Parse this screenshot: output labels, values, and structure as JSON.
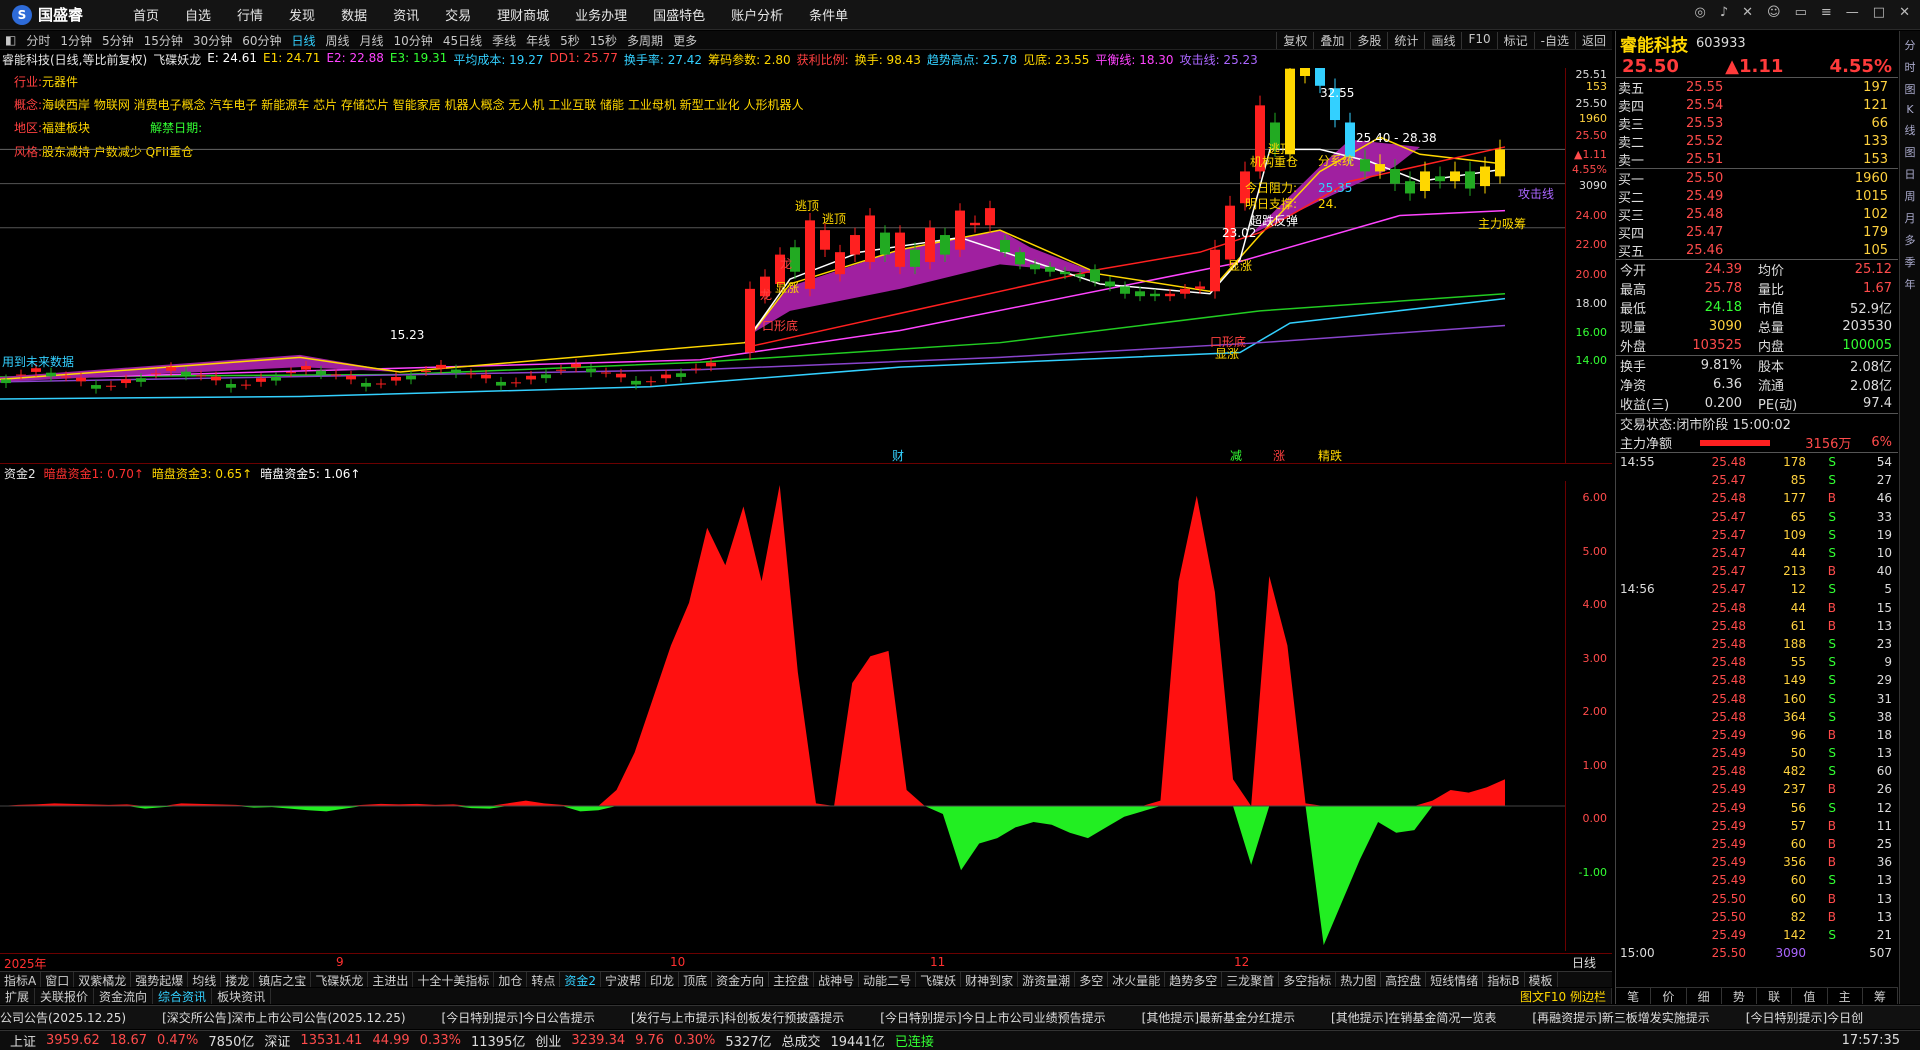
{
  "app": {
    "logo": "国盛睿",
    "menu": [
      "首页",
      "自选",
      "行情",
      "发现",
      "数据",
      "资讯",
      "交易",
      "理财商城",
      "业务办理",
      "国盛特色",
      "账户分析",
      "条件单"
    ]
  },
  "periods": [
    "分时",
    "1分钟",
    "5分钟",
    "15分钟",
    "30分钟",
    "60分钟",
    "日线",
    "周线",
    "月线",
    "10分钟",
    "45日线",
    "季线",
    "年线",
    "5秒",
    "15秒",
    "多周期",
    "更多"
  ],
  "active_period": "日线",
  "toolbar_right": [
    "复权",
    "叠加",
    "多股",
    "统计",
    "画线",
    "F10",
    "标记",
    "-自选",
    "返回"
  ],
  "legend": [
    {
      "t": "睿能科技(日线,等比前复权)",
      "c": "#e6e6e6"
    },
    {
      "t": "飞碟妖龙",
      "c": "#e6e6e6"
    },
    {
      "t": "E: 24.61",
      "c": "#ffffff"
    },
    {
      "t": "E1: 24.71",
      "c": "#ffd700"
    },
    {
      "t": "E2: 22.88",
      "c": "#ff44ff"
    },
    {
      "t": "E3: 19.31",
      "c": "#33ff33"
    },
    {
      "t": "平均成本: 19.27",
      "c": "#33d0ff"
    },
    {
      "t": "DD1: 25.77",
      "c": "#ff4040"
    },
    {
      "t": "换手率: 27.42",
      "c": "#33d0ff"
    },
    {
      "t": "筹码参数: 2.80",
      "c": "#ffd700"
    },
    {
      "t": "获利比例:",
      "c": "#ff4040"
    },
    {
      "t": "换手: 98.43",
      "c": "#ffd700"
    },
    {
      "t": "趋势高点: 25.78",
      "c": "#33d0ff"
    },
    {
      "t": "见底: 23.55",
      "c": "#ffd700"
    },
    {
      "t": "平衡线: 18.30",
      "c": "#ff44ff"
    },
    {
      "t": "攻击线: 25.23",
      "c": "#aa66ff"
    }
  ],
  "info": {
    "industry_label": "行业:",
    "industry": "元器件",
    "concept_label": "概念:",
    "concept": "海峡西岸 物联网 消费电子概念 汽车电子 新能源车 芯片 存储芯片 智能家居 机器人概念 无人机 工业互联 储能 工业母机 新型工业化 人形机器人",
    "region_label": "地区:",
    "region": "福建板块",
    "unlock_label": "解禁日期:",
    "style_label": "风格:",
    "style": "股东减持 户数减少 QFII重仓"
  },
  "main_axis": [
    "25.51",
    "153",
    "25.50",
    "1960",
    "25.50",
    "▲1.11",
    "4.55%",
    "3090",
    "24.00",
    "22.00",
    "20.00",
    "18.00",
    "16.00",
    "14.00"
  ],
  "annotations": {
    "high": "32.55",
    "low": "15.23",
    "ref": "25.40 - 28.38",
    "ref2": "23.02",
    "attack": "攻击线",
    "main_buy": "主力吸筹",
    "no_data": "用到未来数据",
    "labels": [
      "逃顶",
      "逃顶",
      "龙",
      "龙",
      "显涨",
      "显涨",
      "口形底",
      "口形底",
      "显涨",
      "机构重仓",
      "分系统",
      "逃顶",
      "今日阻力:",
      "25.35",
      "明日支撑:",
      "24.",
      "超跌反弹"
    ]
  },
  "events": [
    "财",
    "减",
    "涨",
    "精跌"
  ],
  "sub_legend": [
    {
      "t": "资金2",
      "c": "#e6e6e6"
    },
    {
      "t": "暗盘资金1: 0.70↑",
      "c": "#ff3030"
    },
    {
      "t": "暗盘资金3: 0.65↑",
      "c": "#ffd700"
    },
    {
      "t": "暗盘资金5: 1.06↑",
      "c": "#ffffff"
    }
  ],
  "sub_axis": [
    "6.00",
    "5.00",
    "4.00",
    "3.00",
    "2.00",
    "1.00",
    "0.00",
    "-1.00"
  ],
  "dates": [
    "2025年",
    "9",
    "10",
    "11",
    "12"
  ],
  "period_label": "日线",
  "bottom_tabs": [
    "指标A",
    "窗口",
    "双紫橘龙",
    "强势起爆",
    "均线",
    "搂龙",
    "镇店之宝",
    "飞碟妖龙",
    "主进出",
    "十全十美指标",
    "加仓",
    "转点",
    "资金2",
    "宁波帮",
    "印龙",
    "顶底",
    "资金方向",
    "主控盘",
    "战神号",
    "动能二号",
    "飞碟妖",
    "财神到家",
    "游资量潮",
    "多空",
    "冰火量能",
    "趋势多空",
    "三龙聚首",
    "多空指标",
    "热力图",
    "高控盘",
    "短线情绪",
    "指标B",
    "模板"
  ],
  "active_bottom": "资金2",
  "tabs2": [
    "扩展",
    "关联报价",
    "资金流向",
    "综合资讯",
    "板块资讯"
  ],
  "active_tab2": "综合资讯",
  "tabs2_right": "图文F10 例边栏",
  "ticker": [
    "公司公告(2025.12.25)",
    "[深交所公告]深市上市公司公告(2025.12.25)",
    "[今日特别提示]今日公告提示",
    "[发行与上市提示]科创板发行预披露提示",
    "[今日特别提示]今日上市公司业绩预告提示",
    "[其他提示]最新基金分红提示",
    "[其他提示]在销基金简况一览表",
    "[再融资提示]新三板增发实施提示",
    "[今日特别提示]今日创"
  ],
  "status": {
    "sh_label": "上证",
    "sh": "3959.62",
    "sh_chg": "18.67",
    "sh_pct": "0.47%",
    "sh_amt": "7850亿",
    "sz_label": "深证",
    "sz": "13531.41",
    "sz_chg": "44.99",
    "sz_pct": "0.33%",
    "sz_amt": "11395亿",
    "cy_label": "创业",
    "cy": "3239.34",
    "cy_chg": "9.76",
    "cy_pct": "0.30%",
    "cy_amt": "5327亿",
    "total_label": "总成交",
    "total": "19441亿",
    "conn": "已连接",
    "time": "17:57:35"
  },
  "quote": {
    "name": "睿能科技",
    "code": "603933",
    "price": "25.50",
    "change": "▲1.11",
    "pct": "4.55%",
    "asks": [
      {
        "l": "卖五",
        "p": "25.55",
        "v": "197"
      },
      {
        "l": "卖四",
        "p": "25.54",
        "v": "121"
      },
      {
        "l": "卖三",
        "p": "25.53",
        "v": "66"
      },
      {
        "l": "卖二",
        "p": "25.52",
        "v": "133"
      },
      {
        "l": "卖一",
        "p": "25.51",
        "v": "153"
      }
    ],
    "bids": [
      {
        "l": "买一",
        "p": "25.50",
        "v": "1960"
      },
      {
        "l": "买二",
        "p": "25.49",
        "v": "1015"
      },
      {
        "l": "买三",
        "p": "25.48",
        "v": "102"
      },
      {
        "l": "买四",
        "p": "25.47",
        "v": "179"
      },
      {
        "l": "买五",
        "p": "25.46",
        "v": "105"
      }
    ],
    "stats": [
      {
        "k": "今开",
        "v": "24.39",
        "vc": "#ff4b4b",
        "k2": "均价",
        "v2": "25.12",
        "v2c": "#ff4b4b"
      },
      {
        "k": "最高",
        "v": "25.78",
        "vc": "#ff4b4b",
        "k2": "量比",
        "v2": "1.67",
        "v2c": "#ff4b4b"
      },
      {
        "k": "最低",
        "v": "24.18",
        "vc": "#33ff33",
        "k2": "市值",
        "v2": "52.9亿",
        "v2c": "#ddd"
      },
      {
        "k": "现量",
        "v": "3090",
        "vc": "#ffd23f",
        "k2": "总量",
        "v2": "203530",
        "v2c": "#ddd"
      },
      {
        "k": "外盘",
        "v": "103525",
        "vc": "#ff4b4b",
        "k2": "内盘",
        "v2": "100005",
        "v2c": "#33ff33"
      }
    ],
    "stats2": [
      {
        "k": "换手",
        "v": "9.81%",
        "k2": "股本",
        "v2": "2.08亿"
      },
      {
        "k": "净资",
        "v": "6.36",
        "k2": "流通",
        "v2": "2.08亿"
      },
      {
        "k": "收益(三)",
        "v": "0.200",
        "k2": "PE(动)",
        "v2": "97.4"
      }
    ],
    "trade_state_label": "交易状态:",
    "trade_state": "闭市阶段 15:00:02",
    "main_net_label": "主力净额",
    "main_net": "3156万",
    "main_net_pct": "6%",
    "trades": [
      {
        "t": "14:55",
        "p": "25.48",
        "v": "178",
        "bs": "S",
        "n": "54"
      },
      {
        "t": "",
        "p": "25.47",
        "v": "85",
        "bs": "S",
        "n": "27"
      },
      {
        "t": "",
        "p": "25.48",
        "v": "177",
        "bs": "B",
        "n": "46"
      },
      {
        "t": "",
        "p": "25.47",
        "v": "65",
        "bs": "S",
        "n": "33"
      },
      {
        "t": "",
        "p": "25.47",
        "v": "109",
        "bs": "S",
        "n": "19"
      },
      {
        "t": "",
        "p": "25.47",
        "v": "44",
        "bs": "S",
        "n": "10"
      },
      {
        "t": "",
        "p": "25.47",
        "v": "213",
        "bs": "B",
        "n": "40"
      },
      {
        "t": "14:56",
        "p": "25.47",
        "v": "12",
        "bs": "S",
        "n": "5"
      },
      {
        "t": "",
        "p": "25.48",
        "v": "44",
        "bs": "B",
        "n": "15"
      },
      {
        "t": "",
        "p": "25.48",
        "v": "61",
        "bs": "B",
        "n": "13"
      },
      {
        "t": "",
        "p": "25.48",
        "v": "188",
        "bs": "S",
        "n": "23"
      },
      {
        "t": "",
        "p": "25.48",
        "v": "55",
        "bs": "S",
        "n": "9"
      },
      {
        "t": "",
        "p": "25.48",
        "v": "149",
        "bs": "S",
        "n": "29"
      },
      {
        "t": "",
        "p": "25.48",
        "v": "160",
        "bs": "S",
        "n": "31"
      },
      {
        "t": "",
        "p": "25.48",
        "v": "364",
        "bs": "S",
        "n": "38"
      },
      {
        "t": "",
        "p": "25.49",
        "v": "96",
        "bs": "B",
        "n": "18"
      },
      {
        "t": "",
        "p": "25.49",
        "v": "50",
        "bs": "S",
        "n": "13"
      },
      {
        "t": "",
        "p": "25.48",
        "v": "482",
        "bs": "S",
        "n": "60"
      },
      {
        "t": "",
        "p": "25.49",
        "v": "237",
        "bs": "B",
        "n": "26"
      },
      {
        "t": "",
        "p": "25.49",
        "v": "56",
        "bs": "S",
        "n": "12"
      },
      {
        "t": "",
        "p": "25.49",
        "v": "57",
        "bs": "B",
        "n": "11"
      },
      {
        "t": "",
        "p": "25.49",
        "v": "60",
        "bs": "B",
        "n": "25"
      },
      {
        "t": "",
        "p": "25.49",
        "v": "356",
        "bs": "B",
        "n": "36"
      },
      {
        "t": "",
        "p": "25.49",
        "v": "60",
        "bs": "S",
        "n": "13"
      },
      {
        "t": "",
        "p": "25.50",
        "v": "60",
        "bs": "B",
        "n": "13"
      },
      {
        "t": "",
        "p": "25.50",
        "v": "82",
        "bs": "B",
        "n": "13"
      },
      {
        "t": "",
        "p": "25.49",
        "v": "142",
        "bs": "S",
        "n": "21"
      },
      {
        "t": "15:00",
        "p": "25.50",
        "v": "3090",
        "bs": "",
        "n": "507"
      }
    ],
    "foot": [
      "笔",
      "价",
      "细",
      "势",
      "联",
      "值",
      "主",
      "筹"
    ]
  },
  "sidebar": [
    "分",
    "时",
    "图",
    "K",
    "线",
    "图",
    "日",
    "周",
    "月",
    "多",
    "季",
    "年"
  ],
  "fund_series": [
    0,
    0.02,
    0.03,
    0.05,
    0.04,
    0.03,
    0.02,
    0.03,
    -0.05,
    -0.02,
    0.05,
    0.04,
    0.03,
    0.02,
    -0.03,
    -0.02,
    -0.05,
    -0.08,
    -0.1,
    -0.05,
    0.02,
    0.04,
    0.03,
    0.04,
    0.02,
    0.03,
    -0.04,
    -0.05,
    0.05,
    0.1,
    0.05,
    0.02,
    -0.1,
    -0.08,
    0.3,
    1.0,
    2.0,
    3.0,
    3.8,
    5.2,
    4.5,
    5.6,
    4.2,
    6.0,
    2.5,
    0.05,
    0,
    2.3,
    2.8,
    2.9,
    0.3,
    0,
    -0.15,
    -1.2,
    -0.7,
    -0.6,
    -0.4,
    -0.3,
    -0.35,
    -0.5,
    -0.6,
    -0.4,
    -0.2,
    -0.1,
    0.1,
    4.2,
    5.8,
    4.0,
    0.5,
    -1.1,
    4.3,
    3.0,
    0.05,
    -2.6,
    -1.8,
    -1.0,
    -0.3,
    -0.5,
    -0.45,
    0.1,
    0.3,
    0.25,
    0.35,
    0.5
  ]
}
